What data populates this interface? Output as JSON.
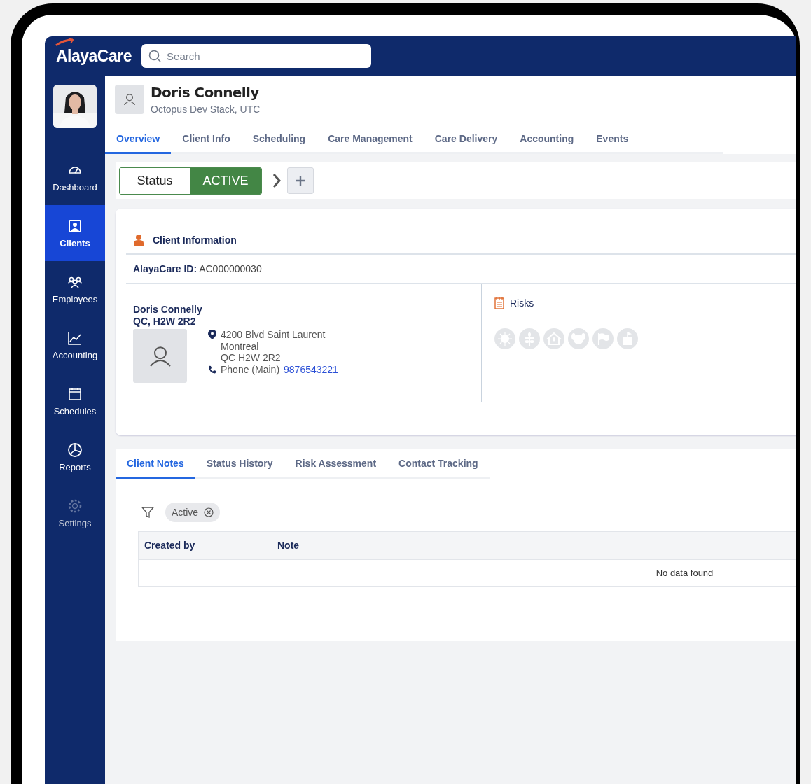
{
  "header": {
    "logo": "AlayaCare",
    "search": {
      "placeholder": "Search"
    }
  },
  "sidebar": {
    "items": [
      {
        "label": "Dashboard",
        "selected": false,
        "disabled": false
      },
      {
        "label": "Clients",
        "selected": true,
        "disabled": false
      },
      {
        "label": "Employees",
        "selected": false,
        "disabled": false
      },
      {
        "label": "Accounting",
        "selected": false,
        "disabled": false
      },
      {
        "label": "Schedules",
        "selected": false,
        "disabled": false
      },
      {
        "label": "Reports",
        "selected": false,
        "disabled": false
      },
      {
        "label": "Settings",
        "selected": false,
        "disabled": true
      }
    ]
  },
  "client": {
    "name": "Doris Connelly",
    "subtitle": "Octopus Dev Stack, UTC"
  },
  "tabs": [
    {
      "label": "Overview",
      "selected": true
    },
    {
      "label": "Client Info",
      "selected": false
    },
    {
      "label": "Scheduling",
      "selected": false
    },
    {
      "label": "Care Management",
      "selected": false
    },
    {
      "label": "Care Delivery",
      "selected": false
    },
    {
      "label": "Accounting",
      "selected": false
    },
    {
      "label": "Events",
      "selected": false
    }
  ],
  "status": {
    "label": "Status",
    "value": "ACTIVE"
  },
  "client_information": {
    "title": "Client Information",
    "id_line": "**AlayaCare ID:** AC000000030",
    "name": "Doris Connelly",
    "region": "QC, H2W 2R2",
    "address": [
      "4200 Blvd Saint Laurent",
      "Montreal",
      "QC H2W 2R2"
    ],
    "phone_label": "Phone (Main)",
    "phone": "9876543221"
  },
  "risks": {
    "title": "Risks"
  },
  "notes_tabs": [
    {
      "label": "Client Notes",
      "selected": true
    },
    {
      "label": "Status History",
      "selected": false
    },
    {
      "label": "Risk Assessment",
      "selected": false
    },
    {
      "label": "Contact Tracking",
      "selected": false
    }
  ],
  "filter_chip": "Active",
  "table": {
    "columns": [
      "Created by",
      "Note"
    ],
    "empty_message": "No data found"
  }
}
